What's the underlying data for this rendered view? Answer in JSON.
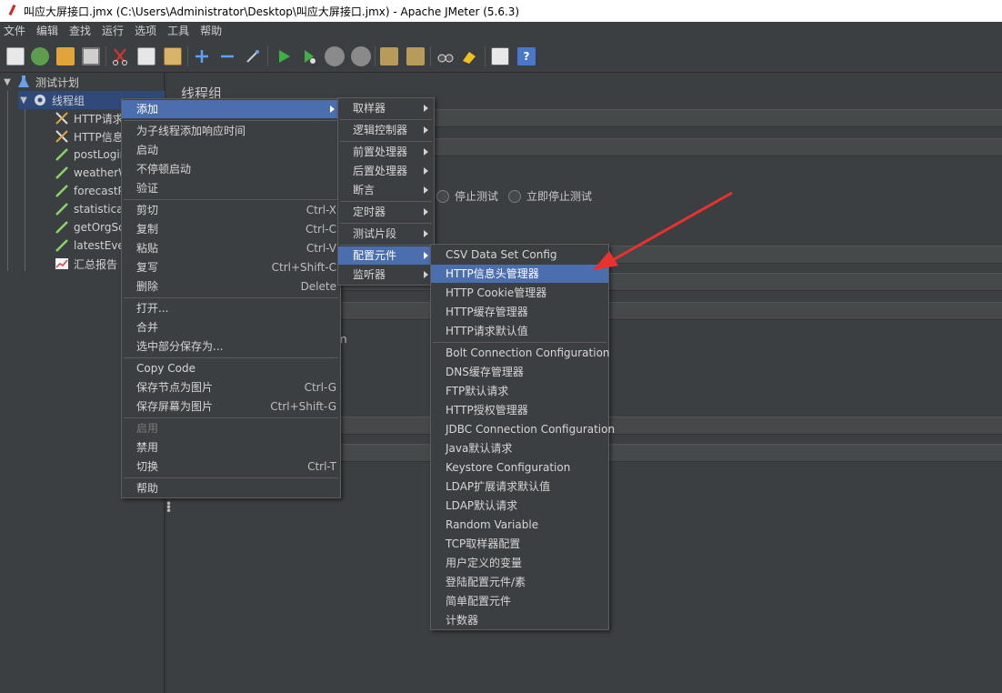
{
  "window": {
    "title": "叫应大屏接口.jmx (C:\\Users\\Administrator\\Desktop\\叫应大屏接口.jmx) - Apache JMeter (5.6.3)"
  },
  "menubar": [
    "文件",
    "编辑",
    "查找",
    "运行",
    "选项",
    "工具",
    "帮助"
  ],
  "toolbar_icons": [
    "new-icon",
    "templates-icon",
    "open-icon",
    "save-icon",
    "cut-icon",
    "copy-icon",
    "paste-icon",
    "expand-icon",
    "collapse-icon",
    "toggle-icon",
    "start-icon",
    "start-no-pause-icon",
    "stop-icon",
    "shutdown-icon",
    "clear-icon",
    "clear-all-icon",
    "search-icon",
    "reset-search-icon",
    "function-helper-icon",
    "help-icon"
  ],
  "tree": {
    "root": "测试计划",
    "thread_group": "线程组",
    "children": [
      "HTTP请求",
      "HTTP信息",
      "postLogin",
      "weatherW",
      "forecastP",
      "statistica",
      "getOrgSc",
      "latestEver",
      "汇总报告"
    ]
  },
  "panel": {
    "title": "线程组",
    "radio_stop_test": "停止测试",
    "radio_stop_now": "立即停止测试",
    "partial_text": "n"
  },
  "context_menu": {
    "add": "添加",
    "add_response_time": "为子线程添加响应时间",
    "start": "启动",
    "start_no_pause": "不停顿启动",
    "validate": "验证",
    "cut": "剪切",
    "cut_key": "Ctrl-X",
    "copy": "复制",
    "copy_key": "Ctrl-C",
    "paste": "粘贴",
    "paste_key": "Ctrl-V",
    "duplicate": "复写",
    "duplicate_key": "Ctrl+Shift-C",
    "delete": "删除",
    "delete_key": "Delete",
    "open": "打开...",
    "merge": "合并",
    "save_selection": "选中部分保存为...",
    "copy_code": "Copy Code",
    "save_node_image": "保存节点为图片",
    "save_node_image_key": "Ctrl-G",
    "save_screen_image": "保存屏幕为图片",
    "save_screen_image_key": "Ctrl+Shift-G",
    "enable": "启用",
    "disable": "禁用",
    "toggle": "切换",
    "toggle_key": "Ctrl-T",
    "help": "帮助"
  },
  "add_submenu": {
    "sampler": "取样器",
    "logic_controller": "逻辑控制器",
    "pre_processor": "前置处理器",
    "post_processor": "后置处理器",
    "assertion": "断言",
    "timer": "定时器",
    "test_fragment": "测试片段",
    "config_element": "配置元件",
    "listener": "监听器"
  },
  "config_submenu": {
    "csv": "CSV Data Set Config",
    "header_manager": "HTTP信息头管理器",
    "cookie_manager": "HTTP Cookie管理器",
    "cache_manager": "HTTP缓存管理器",
    "request_defaults": "HTTP请求默认值",
    "bolt": "Bolt Connection Configuration",
    "dns_cache": "DNS缓存管理器",
    "ftp_defaults": "FTP默认请求",
    "auth_manager": "HTTP授权管理器",
    "jdbc": "JDBC Connection Configuration",
    "java_defaults": "Java默认请求",
    "keystore": "Keystore Configuration",
    "ldap_ext_defaults": "LDAP扩展请求默认值",
    "ldap_defaults": "LDAP默认请求",
    "random_variable": "Random Variable",
    "tcp_config": "TCP取样器配置",
    "user_vars": "用户定义的变量",
    "login_config": "登陆配置元件/素",
    "simple_config": "简单配置元件",
    "counter": "计数器"
  },
  "colors": {
    "highlight": "#4b6eaf",
    "background": "#3c3f41",
    "annotation_arrow": "#e8322d"
  }
}
